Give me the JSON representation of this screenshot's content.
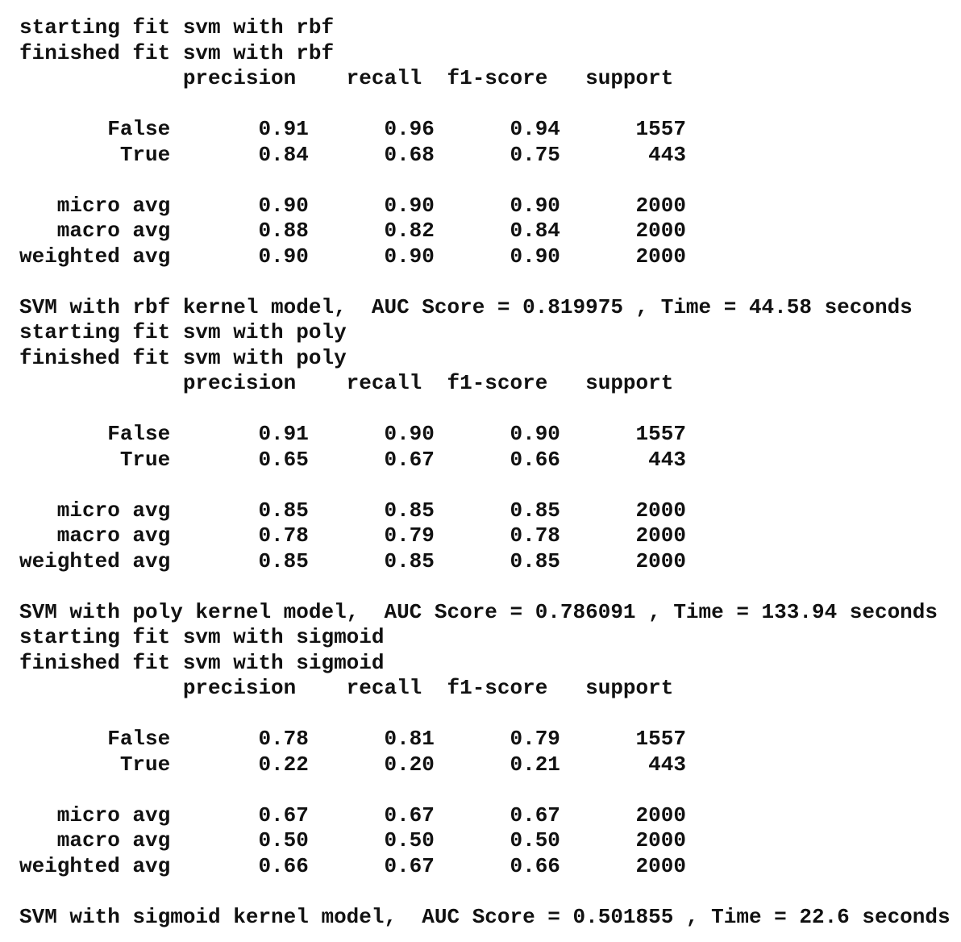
{
  "console": {
    "lines": [
      "starting fit svm with rbf",
      "finished fit svm with rbf",
      "             precision    recall  f1-score   support",
      "",
      "       False       0.91      0.96      0.94      1557",
      "        True       0.84      0.68      0.75       443",
      "",
      "   micro avg       0.90      0.90      0.90      2000",
      "   macro avg       0.88      0.82      0.84      2000",
      "weighted avg       0.90      0.90      0.90      2000",
      "",
      "SVM with rbf kernel model,  AUC Score = 0.819975 , Time = 44.58 seconds",
      "starting fit svm with poly",
      "finished fit svm with poly",
      "             precision    recall  f1-score   support",
      "",
      "       False       0.91      0.90      0.90      1557",
      "        True       0.65      0.67      0.66       443",
      "",
      "   micro avg       0.85      0.85      0.85      2000",
      "   macro avg       0.78      0.79      0.78      2000",
      "weighted avg       0.85      0.85      0.85      2000",
      "",
      "SVM with poly kernel model,  AUC Score = 0.786091 , Time = 133.94 seconds",
      "starting fit svm with sigmoid",
      "finished fit svm with sigmoid",
      "             precision    recall  f1-score   support",
      "",
      "       False       0.78      0.81      0.79      1557",
      "        True       0.22      0.20      0.21       443",
      "",
      "   micro avg       0.67      0.67      0.67      2000",
      "   macro avg       0.50      0.50      0.50      2000",
      "weighted avg       0.66      0.67      0.66      2000",
      "",
      "SVM with sigmoid kernel model,  AUC Score = 0.501855 , Time = 22.6 seconds"
    ]
  }
}
